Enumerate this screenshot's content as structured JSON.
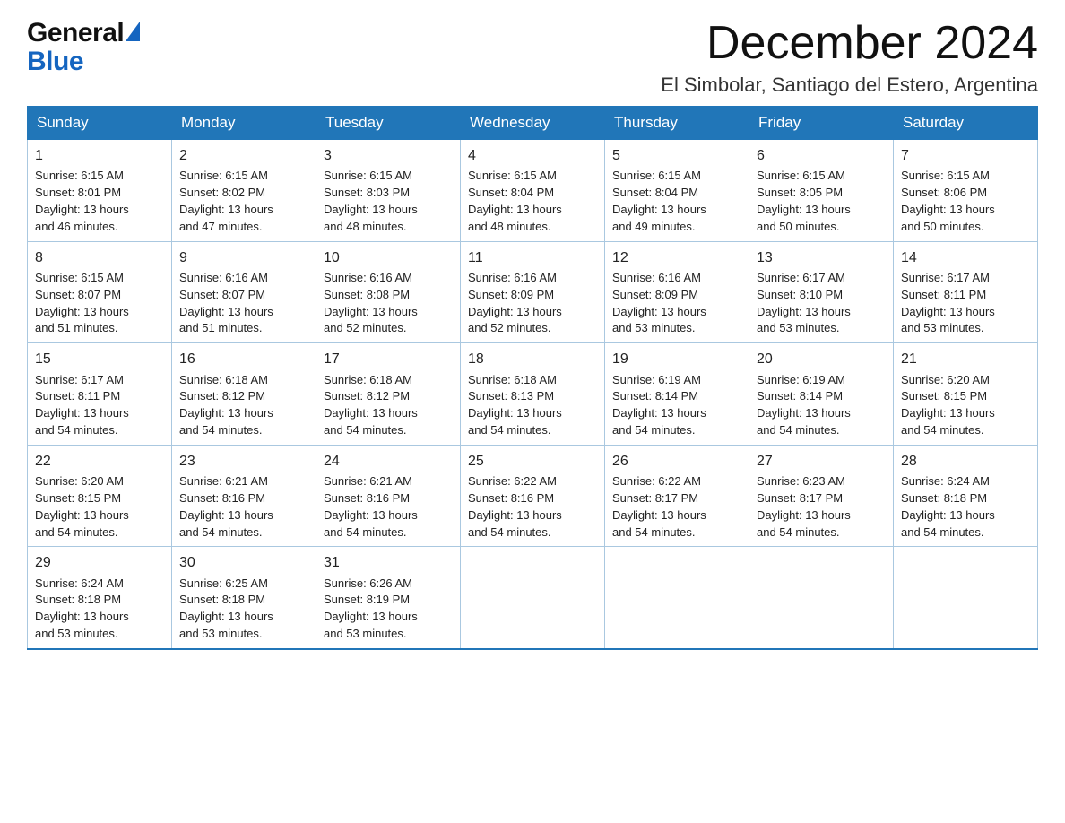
{
  "logo": {
    "general": "General",
    "blue": "Blue"
  },
  "header": {
    "title": "December 2024",
    "subtitle": "El Simbolar, Santiago del Estero, Argentina"
  },
  "weekdays": [
    "Sunday",
    "Monday",
    "Tuesday",
    "Wednesday",
    "Thursday",
    "Friday",
    "Saturday"
  ],
  "weeks": [
    [
      {
        "day": "1",
        "sunrise": "6:15 AM",
        "sunset": "8:01 PM",
        "daylight": "13 hours and 46 minutes."
      },
      {
        "day": "2",
        "sunrise": "6:15 AM",
        "sunset": "8:02 PM",
        "daylight": "13 hours and 47 minutes."
      },
      {
        "day": "3",
        "sunrise": "6:15 AM",
        "sunset": "8:03 PM",
        "daylight": "13 hours and 48 minutes."
      },
      {
        "day": "4",
        "sunrise": "6:15 AM",
        "sunset": "8:04 PM",
        "daylight": "13 hours and 48 minutes."
      },
      {
        "day": "5",
        "sunrise": "6:15 AM",
        "sunset": "8:04 PM",
        "daylight": "13 hours and 49 minutes."
      },
      {
        "day": "6",
        "sunrise": "6:15 AM",
        "sunset": "8:05 PM",
        "daylight": "13 hours and 50 minutes."
      },
      {
        "day": "7",
        "sunrise": "6:15 AM",
        "sunset": "8:06 PM",
        "daylight": "13 hours and 50 minutes."
      }
    ],
    [
      {
        "day": "8",
        "sunrise": "6:15 AM",
        "sunset": "8:07 PM",
        "daylight": "13 hours and 51 minutes."
      },
      {
        "day": "9",
        "sunrise": "6:16 AM",
        "sunset": "8:07 PM",
        "daylight": "13 hours and 51 minutes."
      },
      {
        "day": "10",
        "sunrise": "6:16 AM",
        "sunset": "8:08 PM",
        "daylight": "13 hours and 52 minutes."
      },
      {
        "day": "11",
        "sunrise": "6:16 AM",
        "sunset": "8:09 PM",
        "daylight": "13 hours and 52 minutes."
      },
      {
        "day": "12",
        "sunrise": "6:16 AM",
        "sunset": "8:09 PM",
        "daylight": "13 hours and 53 minutes."
      },
      {
        "day": "13",
        "sunrise": "6:17 AM",
        "sunset": "8:10 PM",
        "daylight": "13 hours and 53 minutes."
      },
      {
        "day": "14",
        "sunrise": "6:17 AM",
        "sunset": "8:11 PM",
        "daylight": "13 hours and 53 minutes."
      }
    ],
    [
      {
        "day": "15",
        "sunrise": "6:17 AM",
        "sunset": "8:11 PM",
        "daylight": "13 hours and 54 minutes."
      },
      {
        "day": "16",
        "sunrise": "6:18 AM",
        "sunset": "8:12 PM",
        "daylight": "13 hours and 54 minutes."
      },
      {
        "day": "17",
        "sunrise": "6:18 AM",
        "sunset": "8:12 PM",
        "daylight": "13 hours and 54 minutes."
      },
      {
        "day": "18",
        "sunrise": "6:18 AM",
        "sunset": "8:13 PM",
        "daylight": "13 hours and 54 minutes."
      },
      {
        "day": "19",
        "sunrise": "6:19 AM",
        "sunset": "8:14 PM",
        "daylight": "13 hours and 54 minutes."
      },
      {
        "day": "20",
        "sunrise": "6:19 AM",
        "sunset": "8:14 PM",
        "daylight": "13 hours and 54 minutes."
      },
      {
        "day": "21",
        "sunrise": "6:20 AM",
        "sunset": "8:15 PM",
        "daylight": "13 hours and 54 minutes."
      }
    ],
    [
      {
        "day": "22",
        "sunrise": "6:20 AM",
        "sunset": "8:15 PM",
        "daylight": "13 hours and 54 minutes."
      },
      {
        "day": "23",
        "sunrise": "6:21 AM",
        "sunset": "8:16 PM",
        "daylight": "13 hours and 54 minutes."
      },
      {
        "day": "24",
        "sunrise": "6:21 AM",
        "sunset": "8:16 PM",
        "daylight": "13 hours and 54 minutes."
      },
      {
        "day": "25",
        "sunrise": "6:22 AM",
        "sunset": "8:16 PM",
        "daylight": "13 hours and 54 minutes."
      },
      {
        "day": "26",
        "sunrise": "6:22 AM",
        "sunset": "8:17 PM",
        "daylight": "13 hours and 54 minutes."
      },
      {
        "day": "27",
        "sunrise": "6:23 AM",
        "sunset": "8:17 PM",
        "daylight": "13 hours and 54 minutes."
      },
      {
        "day": "28",
        "sunrise": "6:24 AM",
        "sunset": "8:18 PM",
        "daylight": "13 hours and 54 minutes."
      }
    ],
    [
      {
        "day": "29",
        "sunrise": "6:24 AM",
        "sunset": "8:18 PM",
        "daylight": "13 hours and 53 minutes."
      },
      {
        "day": "30",
        "sunrise": "6:25 AM",
        "sunset": "8:18 PM",
        "daylight": "13 hours and 53 minutes."
      },
      {
        "day": "31",
        "sunrise": "6:26 AM",
        "sunset": "8:19 PM",
        "daylight": "13 hours and 53 minutes."
      },
      null,
      null,
      null,
      null
    ]
  ],
  "labels": {
    "sunrise": "Sunrise:",
    "sunset": "Sunset:",
    "daylight": "Daylight:"
  }
}
